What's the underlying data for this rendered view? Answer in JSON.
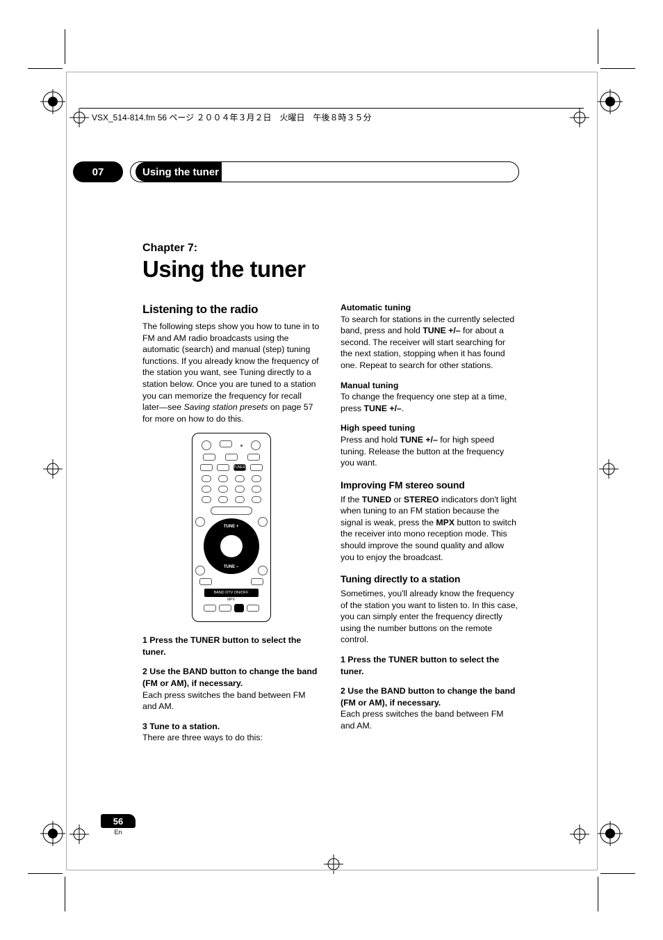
{
  "header_text": "VSX_514-814.fm 56 ページ ２００４年３月２日　火曜日　午後８時３５分",
  "chapter_bar": {
    "number": "07",
    "title": "Using the tuner"
  },
  "chapter": {
    "label": "Chapter 7:",
    "title": "Using the tuner"
  },
  "left": {
    "heading": "Listening to the radio",
    "intro": "The following steps show you how to tune in to FM and AM radio broadcasts using the automatic (search) and manual (step) tuning functions. If you already know the frequency of the station you want, see Tuning directly to a station below. Once you are tuned to a station you can memorize the frequency for recall later—see ",
    "intro_italic": "Saving station presets",
    "intro_after": " on page 57 for more on how to do this.",
    "step1": "1   Press the TUNER button to select the tuner.",
    "step2": "2   Use the BAND button to change the band (FM or AM), if necessary.",
    "step2_body": "Each press switches the band between FM and AM.",
    "step3": "3   Tune to a station.",
    "step3_body": "There are three ways to do this:"
  },
  "remote": {
    "tuner_label": "TUNER",
    "tune_up": "TUNE +",
    "tune_down": "TUNE –",
    "band_bar": "BAND DTV ON/OFF",
    "mpx": "MPX"
  },
  "right": {
    "auto_heading": "Automatic tuning",
    "auto_body_1": "To search for stations in the currently selected band, press and hold ",
    "auto_bold": "TUNE +/–",
    "auto_body_2": " for about a second. The receiver will start searching for the next station, stopping when it has found one. Repeat to search for other stations.",
    "manual_heading": "Manual tuning",
    "manual_body_1": "To change the frequency one step at a time, press ",
    "manual_bold": "TUNE +/–",
    "manual_body_2": ".",
    "high_heading": "High speed tuning",
    "high_body_1": "Press and hold ",
    "high_bold": "TUNE +/–",
    "high_body_2": " for high speed tuning. Release the button at the frequency you want.",
    "fm_heading": "Improving FM stereo sound",
    "fm_body_1": "If the ",
    "fm_bold_1": "TUNED",
    "fm_body_2": " or ",
    "fm_bold_2": "STEREO",
    "fm_body_3": " indicators don't light when tuning to an FM station because the signal is weak, press the ",
    "fm_bold_3": "MPX",
    "fm_body_4": " button to switch the receiver into mono reception mode. This should improve the sound quality and allow you to enjoy the broadcast.",
    "direct_heading": "Tuning directly to a station",
    "direct_body": "Sometimes, you'll already know the frequency of the station you want to listen to. In this case, you can simply enter the frequency directly using the number buttons on the remote control.",
    "direct_step1": "1   Press the TUNER button to select the tuner.",
    "direct_step2": "2   Use the BAND button to change the band (FM or AM), if necessary.",
    "direct_step2_body": "Each press switches the band between FM and AM."
  },
  "page_num": "56",
  "page_lang": "En"
}
